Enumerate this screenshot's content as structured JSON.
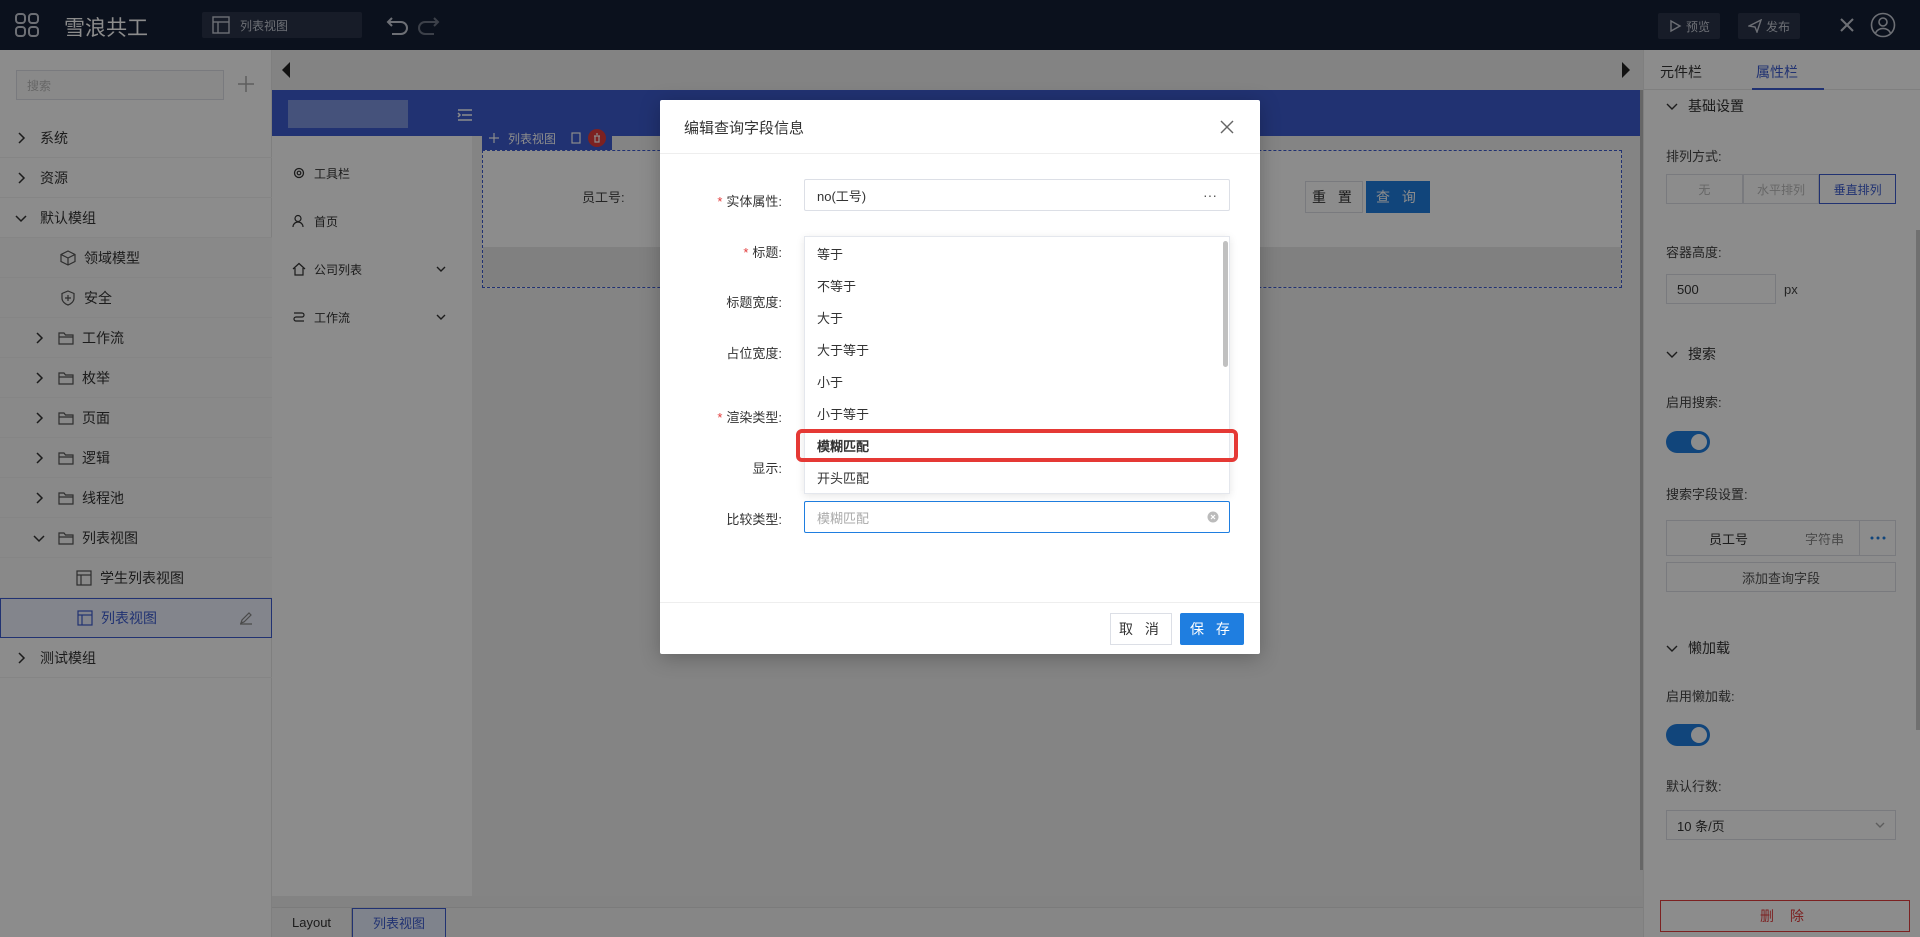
{
  "topbar": {
    "brand": "雪浪共工",
    "current_tab": "列表视图",
    "preview": "预览",
    "publish": "发布"
  },
  "sidebar": {
    "search_placeholder": "搜索",
    "items": [
      {
        "label": "系统"
      },
      {
        "label": "资源"
      },
      {
        "label": "默认模组"
      },
      {
        "label": "领域模型"
      },
      {
        "label": "安全"
      },
      {
        "label": "工作流"
      },
      {
        "label": "枚举"
      },
      {
        "label": "页面"
      },
      {
        "label": "逻辑"
      },
      {
        "label": "线程池"
      },
      {
        "label": "列表视图"
      },
      {
        "label": "学生列表视图"
      },
      {
        "label": "列表视图"
      },
      {
        "label": "测试模组"
      }
    ]
  },
  "canvas": {
    "nav": [
      "工具栏",
      "首页",
      "公司列表",
      "工作流"
    ],
    "chip_label": "列表视图",
    "field_label": "员工号:",
    "reset": "重 置",
    "query": "查 询",
    "breadcrumb": [
      "Layout",
      "列表视图"
    ]
  },
  "right_panel": {
    "tabs": [
      "元件栏",
      "属性栏"
    ],
    "basic_settings": "基础设置",
    "sort_label": "排列方式:",
    "sort_options": [
      "无",
      "水平排列",
      "垂直排列"
    ],
    "height_label": "容器高度:",
    "height_value": "500",
    "height_unit": "px",
    "search_section": "搜索",
    "enable_search": "启用搜索:",
    "search_fields_label": "搜索字段设置:",
    "search_field_name": "员工号",
    "search_field_type": "字符串",
    "add_field": "添加查询字段",
    "lazy_section": "懒加载",
    "enable_lazy": "启用懒加载:",
    "default_rows_label": "默认行数:",
    "default_rows_value": "10 条/页",
    "delete": "删 除"
  },
  "modal": {
    "title": "编辑查询字段信息",
    "labels": {
      "entity": "实体属性:",
      "title": "标题:",
      "title_width": "标题宽度:",
      "placeholder_width": "占位宽度:",
      "render_type": "渲染类型:",
      "display": "显示:",
      "compare_type": "比较类型:"
    },
    "entity_value": "no(工号)",
    "compare_placeholder": "模糊匹配",
    "cancel": "取 消",
    "save": "保 存"
  },
  "dropdown": {
    "options": [
      "等于",
      "不等于",
      "大于",
      "大于等于",
      "小于",
      "小于等于",
      "模糊匹配",
      "开头匹配"
    ],
    "highlighted": "模糊匹配"
  },
  "colors": {
    "topbar": "#152035",
    "accent": "#3c5ccf",
    "primary_button": "#1f7ee0",
    "danger": "#e23c3c"
  }
}
